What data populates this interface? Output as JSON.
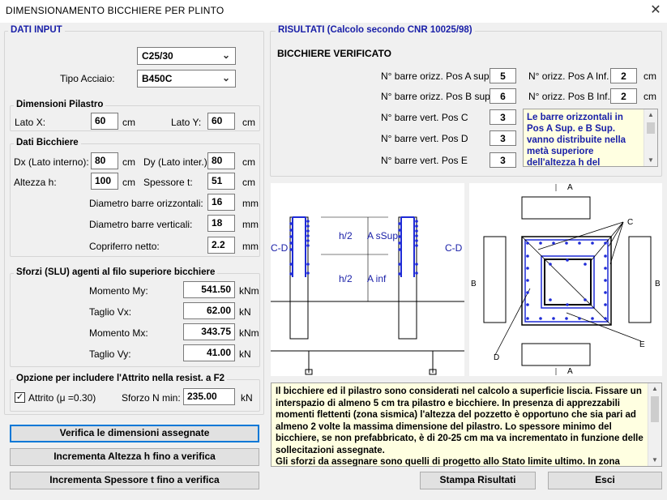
{
  "window": {
    "title": "DIMENSIONAMENTO BICCHIERE PER  PLINTO"
  },
  "input": {
    "section_title": "DATI INPUT",
    "concrete_value": "C25/30",
    "steel_label": "Tipo Acciaio:",
    "steel_value": "B450C",
    "pilastro": {
      "title": "Dimensioni Pilastro",
      "lx_label": "Lato X:",
      "lx_value": "60",
      "lx_unit": "cm",
      "ly_label": "Lato Y:",
      "ly_value": "60",
      "ly_unit": "cm"
    },
    "bicchiere": {
      "title": "Dati Bicchiere",
      "dx_label": "Dx (Lato interno):",
      "dx_value": "80",
      "dx_unit": "cm",
      "dy_label": "Dy (Lato inter.):",
      "dy_value": "80",
      "dy_unit": "cm",
      "h_label": "Altezza  h:",
      "h_value": "100",
      "h_unit": "cm",
      "t_label": "Spessore  t:",
      "t_value": "51",
      "t_unit": "cm",
      "d_orizz_label": "Diametro barre orizzontali:",
      "d_orizz_value": "16",
      "d_orizz_unit": "mm",
      "d_vert_label": "Diametro barre verticali:",
      "d_vert_value": "18",
      "d_vert_unit": "mm",
      "copri_label": "Copriferro netto:",
      "copri_value": "2.2",
      "copri_unit": "mm"
    },
    "sforzi": {
      "title": "Sforzi (SLU) agenti al filo superiore bicchiere",
      "my_label": "Momento  My:",
      "my_value": "541.50",
      "my_unit": "kNm",
      "vx_label": "Taglio  Vx:",
      "vx_value": "62.00",
      "vx_unit": "kN",
      "mx_label": "Momento  Mx:",
      "mx_value": "343.75",
      "mx_unit": "kNm",
      "vy_label": "Taglio  Vy:",
      "vy_value": "41.00",
      "vy_unit": "kN"
    },
    "attrito": {
      "title": "Opzione per includere l'Attrito nella resist. a F2",
      "checkbox_label": "Attrito (μ =0.30)",
      "checked": true,
      "n_label": "Sforzo N min:",
      "n_value": "235.00",
      "n_unit": "kN"
    }
  },
  "buttons": {
    "verifica": "Verifica le dimensioni assegnate",
    "incr_h": "Incrementa Altezza h fino a verifica",
    "incr_t": "Incrementa Spessore t fino a verifica",
    "stampa": "Stampa Risultati",
    "esci": "Esci"
  },
  "results": {
    "section_title": "RISULTATI  (Calcolo secondo CNR 10025/98)",
    "status": "BICCHIERE VERIFICATO",
    "pos_a_sup_label": "N° barre orizz. Pos A sup.",
    "pos_a_sup_value": "5",
    "pos_a_inf_label": "N°  orizz. Pos A Inf.",
    "pos_a_inf_value": "2",
    "pos_a_inf_unit": "cm",
    "pos_b_sup_label": "N° barre orizz. Pos B sup.",
    "pos_b_sup_value": "6",
    "pos_b_inf_label": "N° orizz. Pos B Inf.",
    "pos_b_inf_value": "2",
    "pos_b_inf_unit": "cm",
    "pos_c_label": "N° barre vert. Pos C",
    "pos_c_value": "3",
    "pos_d_label": "N° barre vert. Pos D",
    "pos_d_value": "3",
    "pos_e_label": "N° barre vert. Pos E",
    "pos_e_value": "3",
    "note_lines": [
      "Le barre orizzontali in",
      "Pos A Sup. e B Sup.",
      "vanno distribuite nella",
      "metà superiore",
      "dell'altezza h del"
    ]
  },
  "section_drawing": {
    "h2_top": "h/2",
    "h2_bottom": "h/2",
    "a_sup": "A sSup",
    "a_inf": "A inf",
    "cd_left": "C-D",
    "cd_right": "C-D"
  },
  "plan_drawing": {
    "a_top": "A",
    "a_bottom": "A",
    "b_left": "B",
    "b_right": "B",
    "c": "C",
    "d": "D",
    "e": "E"
  },
  "info_text": [
    "Il bicchiere ed il pilastro sono considerati nel calcolo a superficie liscia. Fissare un",
    "interspazio di almeno 5 cm tra pilastro e bicchiere. In presenza di apprezzabili",
    "momenti flettenti (zona sismica) l'altezza del pozzetto è opportuno che sia pari ad",
    "almeno 2 volte la massima dimensione del pilastro. Lo spessore minimo del",
    "bicchiere, se non prefabbricato, è di 20-25 cm ma va incrementato in funzione delle",
    "sollecitazioni assegnate.",
    "Gli sforzi da assegnare sono quelli di progetto allo Stato limite ultimo. In zona"
  ],
  "colors": {
    "accent_blue": "#1a20a8",
    "rebar": "#1f2bd6",
    "note_bg": "#ffffe1"
  }
}
